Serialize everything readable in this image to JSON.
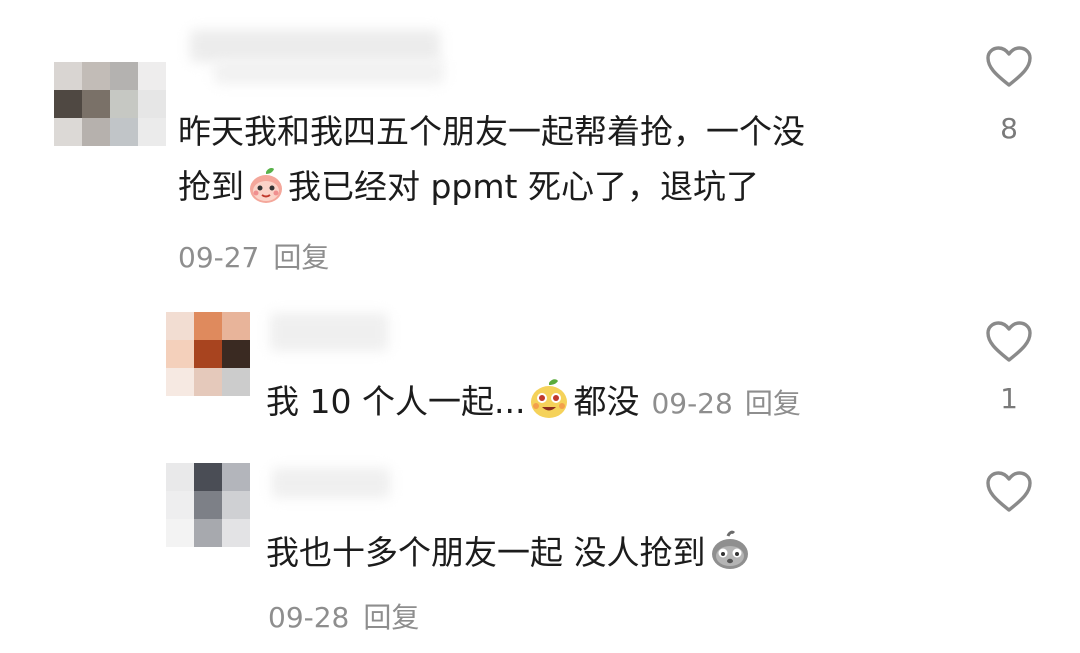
{
  "comments": [
    {
      "username": "",
      "text_line1": "昨天我和我四五个朋友一起帮着抢，一个没",
      "text_line2a": "抢到",
      "text_line2b": "我已经对 ppmt 死心了，退坑了",
      "emoji": "peach-emoji",
      "date": "09-27",
      "reply_label": "回复",
      "likes": "8",
      "avatar_colors": [
        "#d9d5d2",
        "#c2bcb7",
        "#b4b2b0",
        "#eeeded",
        "#4f4842",
        "#7a7168",
        "#c6c8c3",
        "#e6e6e6",
        "#dcd9d6",
        "#b6b1ad",
        "#c1c5c8",
        "#ebebeb"
      ]
    },
    {
      "username": "",
      "text_a": "我 10 个人一起...",
      "text_b": "都没",
      "emoji": "peach-grin-emoji",
      "date": "09-28",
      "reply_label": "回复",
      "likes": "1",
      "avatar_colors": [
        "#f2ddd2",
        "#df8a5d",
        "#e8b49a",
        "#f4d0bb",
        "#a8441f",
        "#3a2a22",
        "#f6e9e2",
        "#e5c9bb",
        "#cccccc"
      ]
    },
    {
      "username": "",
      "text_a": "我也十多个朋友一起 没人抢到",
      "emoji": "gray-sad-emoji",
      "date": "09-28",
      "reply_label": "回复",
      "likes": "",
      "avatar_colors": [
        "#e9e9ea",
        "#4a4d55",
        "#b3b5bb",
        "#eeeeef",
        "#7d8087",
        "#cfd0d3",
        "#f3f3f3",
        "#a7a9ae",
        "#e3e3e5"
      ]
    }
  ],
  "icons": {
    "like": "heart-outline-icon"
  },
  "colors": {
    "text": "#1c1c1c",
    "meta": "#8e8e8e",
    "heart": "#8a8a8a"
  }
}
